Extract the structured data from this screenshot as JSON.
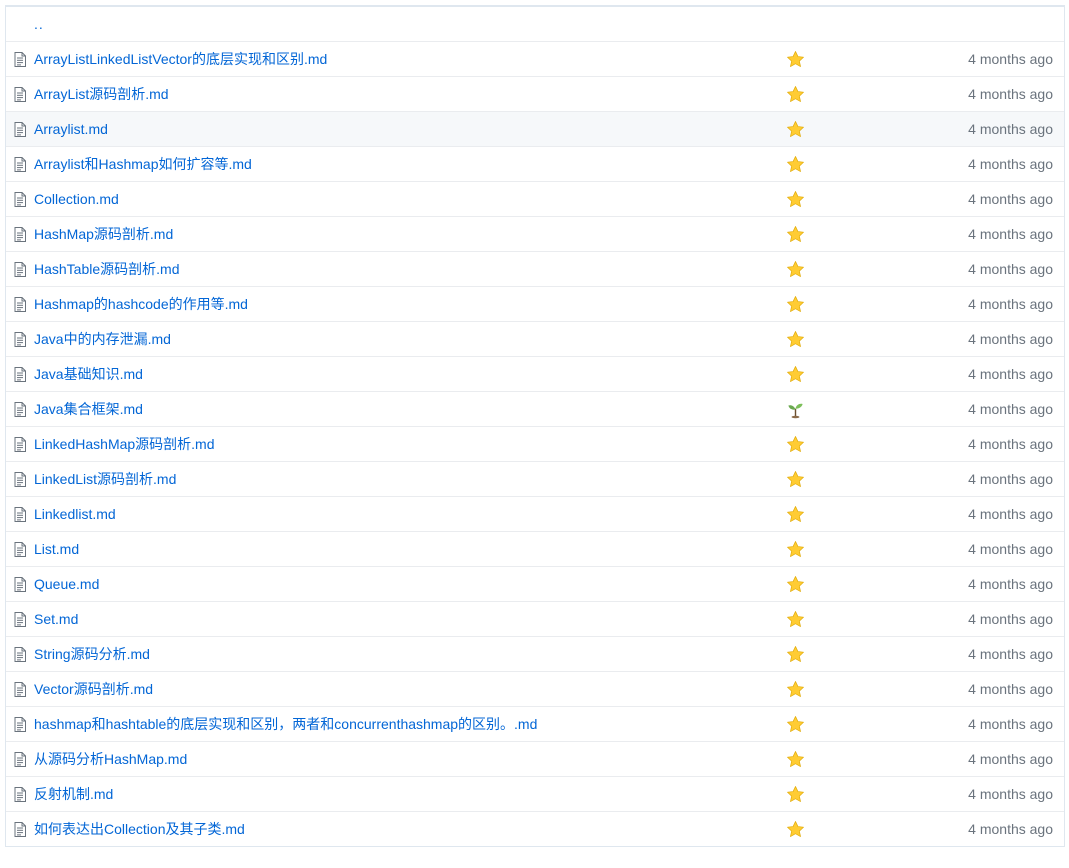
{
  "parent_link": "..",
  "files": [
    {
      "name": "ArrayListLinkedListVector的底层实现和区别.md",
      "emoji": "star",
      "age": "4 months ago"
    },
    {
      "name": "ArrayList源码剖析.md",
      "emoji": "star",
      "age": "4 months ago"
    },
    {
      "name": "Arraylist.md",
      "emoji": "star",
      "age": "4 months ago"
    },
    {
      "name": "Arraylist和Hashmap如何扩容等.md",
      "emoji": "star",
      "age": "4 months ago"
    },
    {
      "name": "Collection.md",
      "emoji": "star",
      "age": "4 months ago"
    },
    {
      "name": "HashMap源码剖析.md",
      "emoji": "star",
      "age": "4 months ago"
    },
    {
      "name": "HashTable源码剖析.md",
      "emoji": "star",
      "age": "4 months ago"
    },
    {
      "name": "Hashmap的hashcode的作用等.md",
      "emoji": "star",
      "age": "4 months ago"
    },
    {
      "name": "Java中的内存泄漏.md",
      "emoji": "star",
      "age": "4 months ago"
    },
    {
      "name": "Java基础知识.md",
      "emoji": "star",
      "age": "4 months ago"
    },
    {
      "name": "Java集合框架.md",
      "emoji": "seedling",
      "age": "4 months ago"
    },
    {
      "name": "LinkedHashMap源码剖析.md",
      "emoji": "star",
      "age": "4 months ago"
    },
    {
      "name": "LinkedList源码剖析.md",
      "emoji": "star",
      "age": "4 months ago"
    },
    {
      "name": "Linkedlist.md",
      "emoji": "star",
      "age": "4 months ago"
    },
    {
      "name": "List.md",
      "emoji": "star",
      "age": "4 months ago"
    },
    {
      "name": "Queue.md",
      "emoji": "star",
      "age": "4 months ago"
    },
    {
      "name": "Set.md",
      "emoji": "star",
      "age": "4 months ago"
    },
    {
      "name": "String源码分析.md",
      "emoji": "star",
      "age": "4 months ago"
    },
    {
      "name": "Vector源码剖析.md",
      "emoji": "star",
      "age": "4 months ago"
    },
    {
      "name": "hashmap和hashtable的底层实现和区别，两者和concurrenthashmap的区别。.md",
      "emoji": "star",
      "age": "4 months ago"
    },
    {
      "name": "从源码分析HashMap.md",
      "emoji": "star",
      "age": "4 months ago"
    },
    {
      "name": "反射机制.md",
      "emoji": "star",
      "age": "4 months ago"
    },
    {
      "name": "如何表达出Collection及其子类.md",
      "emoji": "star",
      "age": "4 months ago"
    }
  ],
  "highlighted_row_index": 2,
  "colors": {
    "link": "#0366d6",
    "age_text": "#6a737d",
    "highlight_bg": "#f6f8fa",
    "border": "#eaecef",
    "star": "#ffcc33",
    "seedling": "#6aa84f"
  }
}
